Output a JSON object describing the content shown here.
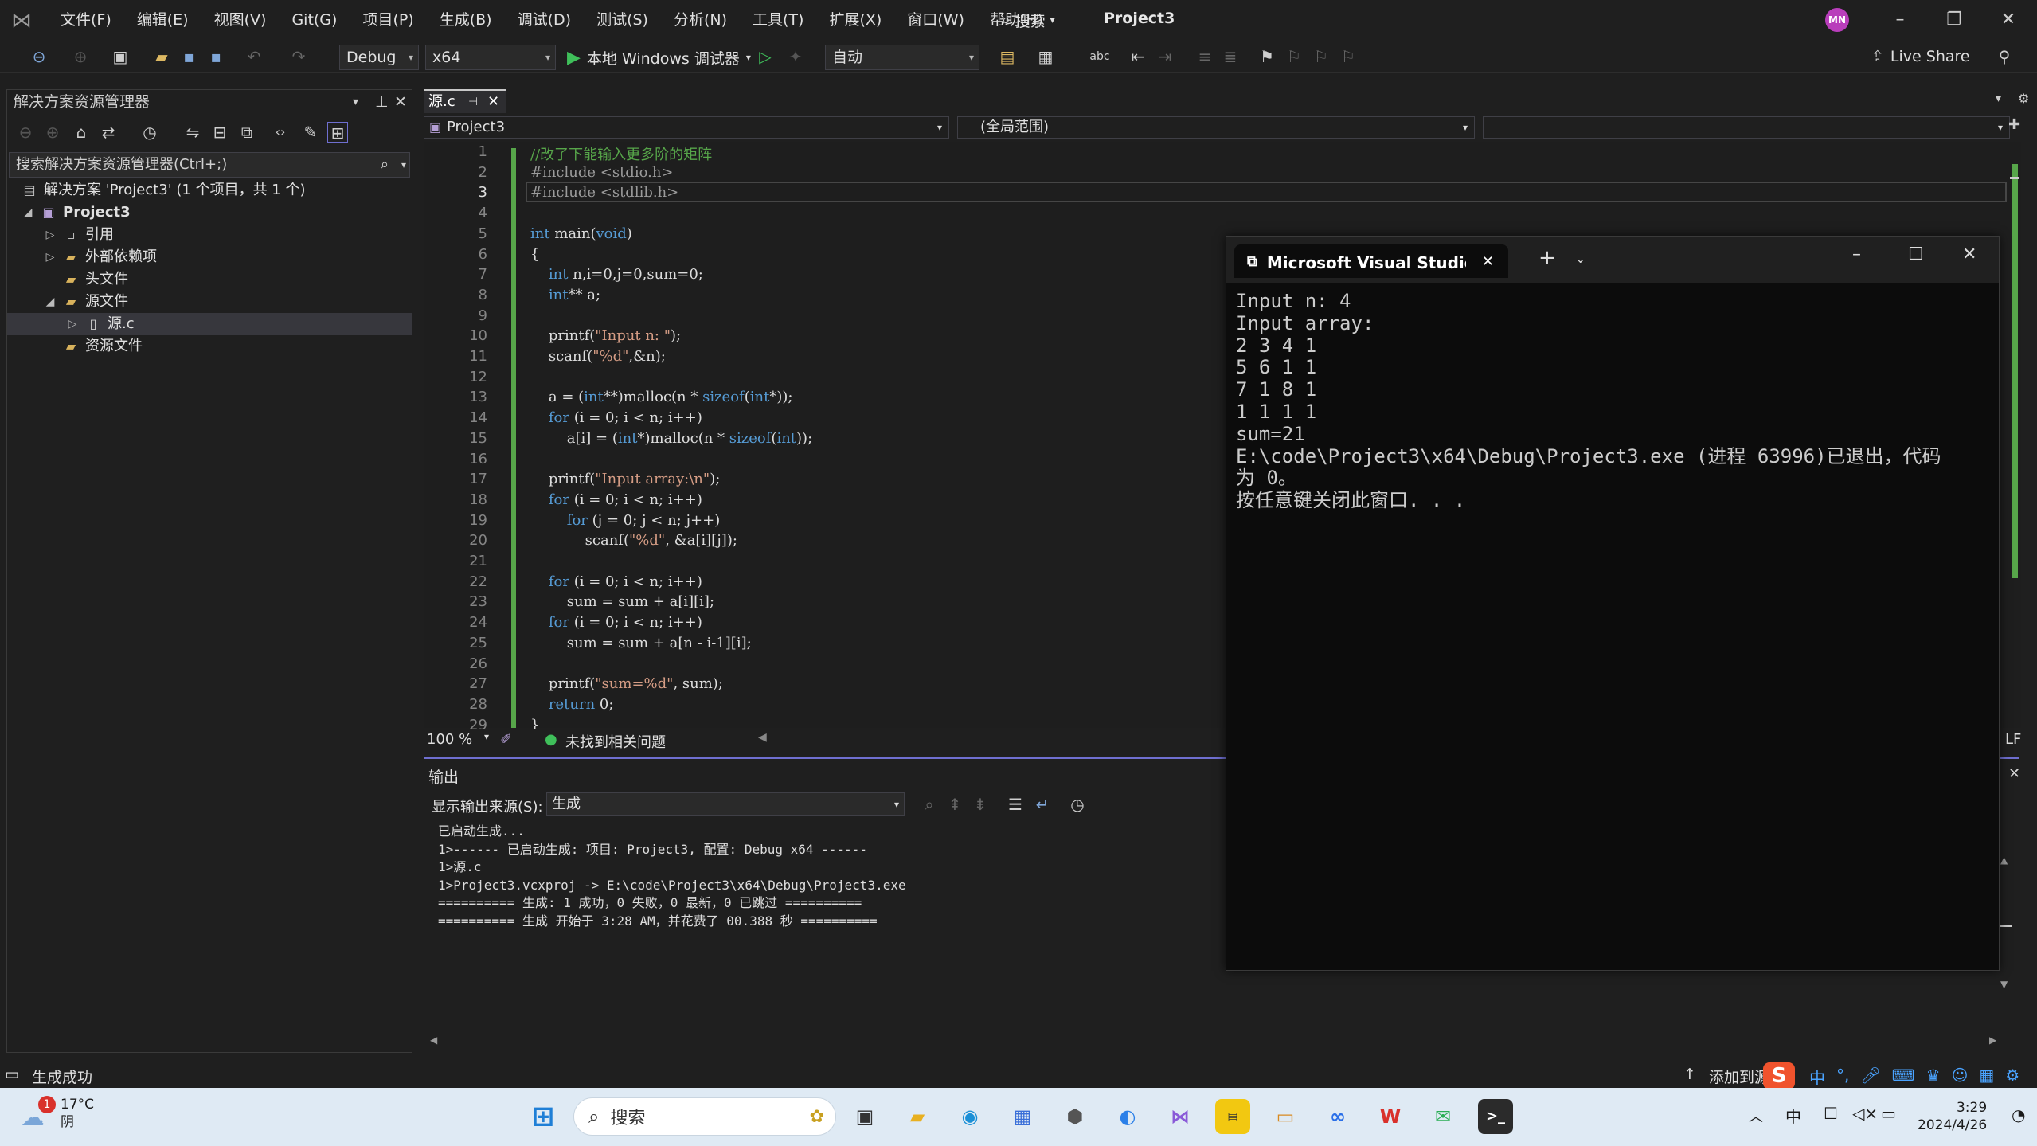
{
  "menu": [
    "文件(F)",
    "编辑(E)",
    "视图(V)",
    "Git(G)",
    "项目(P)",
    "生成(B)",
    "调试(D)",
    "测试(S)",
    "分析(N)",
    "工具(T)",
    "扩展(X)",
    "窗口(W)",
    "帮助(H)"
  ],
  "search_label": "搜索",
  "project_title": "Project3",
  "avatar_initials": "MN",
  "toolbar": {
    "config": "Debug",
    "platform": "x64",
    "run_label": "本地 Windows 调试器",
    "auto_combo": "自动",
    "live_share": "Live Share"
  },
  "solution": {
    "header": "解决方案资源管理器",
    "search_placeholder": "搜索解决方案资源管理器(Ctrl+;)",
    "items": [
      {
        "label": "解决方案 'Project3' (1 个项目，共 1 个)"
      },
      {
        "label": "Project3"
      },
      {
        "label": "引用"
      },
      {
        "label": "外部依赖项"
      },
      {
        "label": "头文件"
      },
      {
        "label": "源文件"
      },
      {
        "label": "源.c"
      },
      {
        "label": "资源文件"
      }
    ]
  },
  "editor": {
    "tab": "源.c",
    "nav_project": "Project3",
    "nav_scope": "(全局范围)",
    "zoom": "100 %",
    "issues": "未找到相关问题",
    "eol": "LF",
    "line_numbers": [
      "1",
      "2",
      "3",
      "4",
      "5",
      "6",
      "7",
      "8",
      "9",
      "10",
      "11",
      "12",
      "13",
      "14",
      "15",
      "16",
      "17",
      "18",
      "19",
      "20",
      "21",
      "22",
      "23",
      "24",
      "25",
      "26",
      "27",
      "28",
      "29"
    ],
    "code": [
      "//改了下能输入更多阶的矩阵",
      "#include <stdio.h>",
      "#include <stdlib.h>",
      "",
      "int main(void)",
      "{",
      "    int n,i=0,j=0,sum=0;",
      "    int** a;",
      "",
      "    printf(\"Input n: \");",
      "    scanf(\"%d\",&n);",
      "",
      "    a = (int**)malloc(n * sizeof(int*));",
      "    for (i = 0; i < n; i++)",
      "        a[i] = (int*)malloc(n * sizeof(int));",
      "",
      "    printf(\"Input array:\\n\");",
      "    for (i = 0; i < n; i++)",
      "        for (j = 0; j < n; j++)",
      "            scanf(\"%d\", &a[i][j]);",
      "",
      "    for (i = 0; i < n; i++)",
      "        sum = sum + a[i][i];",
      "    for (i = 0; i < n; i++)",
      "        sum = sum + a[n - i-1][i];",
      "",
      "    printf(\"sum=%d\", sum);",
      "    return 0;",
      "}"
    ]
  },
  "output": {
    "title": "输出",
    "source_label": "显示输出来源(S):",
    "source_value": "生成",
    "lines": [
      "已启动生成...",
      "1>------ 已启动生成: 项目: Project3, 配置: Debug x64 ------",
      "1>源.c",
      "1>Project3.vcxproj -> E:\\code\\Project3\\x64\\Debug\\Project3.exe",
      "========== 生成: 1 成功，0 失败，0 最新，0 已跳过 ==========",
      "========== 生成 开始于 3:28 AM，并花费了 00.388 秒 =========="
    ]
  },
  "console": {
    "tab_title": "Microsoft Visual Studio 调试",
    "lines": [
      "Input n: 4",
      "Input array:",
      "2 3 4 1",
      "5 6 1 1",
      "7 1 8 1",
      "1 1 1 1",
      "sum=21",
      "E:\\code\\Project3\\x64\\Debug\\Project3.exe (进程 63996)已退出，代码",
      "为 0。",
      "按任意键关闭此窗口. . ."
    ]
  },
  "status": {
    "left": "生成成功",
    "right": "添加到源"
  },
  "taskbar": {
    "temp": "17°C",
    "weather": "阴",
    "badge": "1",
    "search": "搜索",
    "time": "3:29",
    "date": "2024/4/26"
  }
}
